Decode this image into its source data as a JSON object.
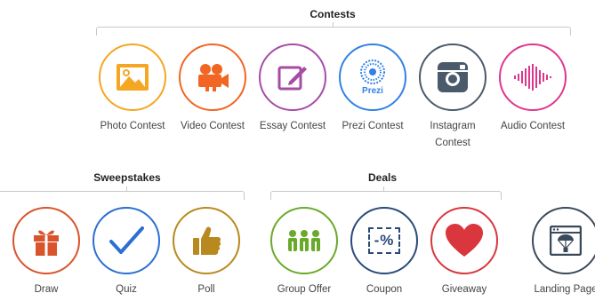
{
  "contests": {
    "heading": "Contests",
    "items": [
      {
        "label": "Photo Contest",
        "icon": "photo-icon",
        "color": "#f5a623"
      },
      {
        "label": "Video Contest",
        "icon": "video-camera-icon",
        "color": "#f26522"
      },
      {
        "label": "Essay Contest",
        "icon": "edit-pencil-icon",
        "color": "#a64ca6"
      },
      {
        "label": "Prezi Contest",
        "icon": "prezi-icon",
        "color": "#3181e6",
        "icon_text": "Prezi"
      },
      {
        "label": "Instagram Contest",
        "icon": "instagram-icon",
        "color": "#4a5a6a"
      },
      {
        "label": "Audio Contest",
        "icon": "audio-wave-icon",
        "color": "#e0358c"
      }
    ]
  },
  "sweepstakes": {
    "heading": "Sweepstakes",
    "items": [
      {
        "label": "Draw",
        "icon": "gift-icon",
        "color": "#d9532c"
      },
      {
        "label": "Quiz",
        "icon": "checkmark-icon",
        "color": "#2c6fd1"
      },
      {
        "label": "Poll",
        "icon": "thumbs-up-icon",
        "color": "#b8891e"
      }
    ]
  },
  "deals": {
    "heading": "Deals",
    "items": [
      {
        "label": "Group Offer",
        "icon": "group-icon",
        "color": "#6aaa2a"
      },
      {
        "label": "Coupon",
        "icon": "coupon-icon",
        "color": "#2a4a7a",
        "icon_text": "-%"
      },
      {
        "label": "Giveaway",
        "icon": "heart-icon",
        "color": "#d9363e"
      }
    ]
  },
  "landing": {
    "label": "Landing Page",
    "icon": "landing-page-icon",
    "color": "#3a4a5a"
  }
}
